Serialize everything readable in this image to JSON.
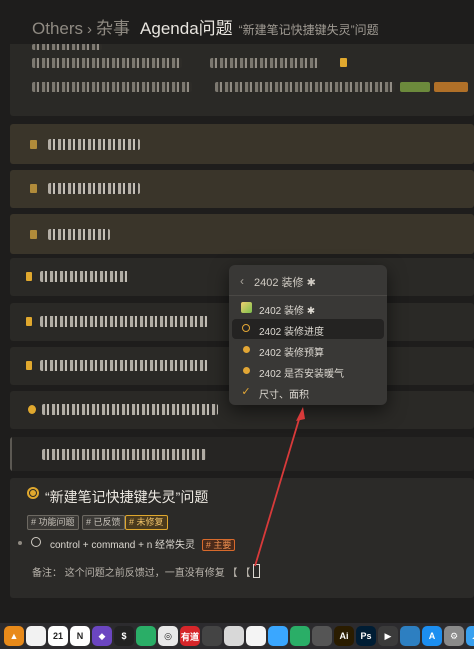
{
  "header": {
    "breadcrumb_root": "Others",
    "breadcrumb_sep": "›",
    "breadcrumb_parent": "杂事",
    "page_title": "Agenda问题",
    "page_subtitle": "“新建笔记快捷键失灵”问题"
  },
  "popup": {
    "back_glyph": "‹",
    "title": "2402 装修 ✱",
    "items": [
      {
        "label": "2402 装修 ✱",
        "icon": "note-icon",
        "selected": false
      },
      {
        "label": "2402 装修进度",
        "icon": "open-circle-icon",
        "selected": true
      },
      {
        "label": "2402 装修预算",
        "icon": "dot-icon",
        "selected": false
      },
      {
        "label": "2402 是否安装暖气",
        "icon": "dot-icon",
        "selected": false
      },
      {
        "label": "尺寸、面积",
        "icon": "check-icon",
        "selected": false
      }
    ]
  },
  "note": {
    "title": "“新建笔记快捷键失灵”问题",
    "tags": [
      "# 功能问题",
      "# 已反馈",
      "# 未修复"
    ],
    "task_text": "control + command + n 经常失灵",
    "task_tag": "# 主要",
    "remark": "备注：  这个问题之前反馈过，一直没有修复 【 【"
  },
  "dock": {
    "icons": [
      {
        "name": "vlc-icon",
        "color": "#e88a1a",
        "glyph": "▲"
      },
      {
        "name": "reminders-icon",
        "color": "#f2f2f2",
        "glyph": ""
      },
      {
        "name": "calendar-icon",
        "color": "#ffffff",
        "glyph": "21"
      },
      {
        "name": "notion-icon",
        "color": "#ffffff",
        "glyph": "N"
      },
      {
        "name": "obsidian-icon",
        "color": "#6b46c1",
        "glyph": "◆"
      },
      {
        "name": "dollar-app-icon",
        "color": "#222222",
        "glyph": "$"
      },
      {
        "name": "wechat-icon",
        "color": "#2aae67",
        "glyph": ""
      },
      {
        "name": "chrome-icon",
        "color": "#e8e8e8",
        "glyph": "◎"
      },
      {
        "name": "youdao-icon",
        "color": "#d6262a",
        "glyph": "有道"
      },
      {
        "name": "grid-app-icon",
        "color": "#444444",
        "glyph": ""
      },
      {
        "name": "pages-icon",
        "color": "#d8d8d8",
        "glyph": ""
      },
      {
        "name": "airmail-icon",
        "color": "#f4f4f4",
        "glyph": ""
      },
      {
        "name": "messages-icon",
        "color": "#3aa7ff",
        "glyph": ""
      },
      {
        "name": "wechat-icon-2",
        "color": "#2aae67",
        "glyph": ""
      },
      {
        "name": "window-app-icon",
        "color": "#555555",
        "glyph": ""
      },
      {
        "name": "illustrator-icon",
        "color": "#2a1c00",
        "glyph": "Ai"
      },
      {
        "name": "photoshop-icon",
        "color": "#001d34",
        "glyph": "Ps"
      },
      {
        "name": "media-player-icon",
        "color": "#3b3b3b",
        "glyph": "▶"
      },
      {
        "name": "agenda-icon",
        "color": "#2d7fc1",
        "glyph": ""
      },
      {
        "name": "app-store-icon",
        "color": "#1c8ef0",
        "glyph": "A"
      },
      {
        "name": "settings-icon",
        "color": "#8a8a8a",
        "glyph": "⚙"
      },
      {
        "name": "cloud-icon",
        "color": "#39a1f0",
        "glyph": "☁"
      }
    ]
  },
  "colors": {
    "accent": "#e2a635",
    "arrow": "#d83a3a",
    "background": "#1e1d1c"
  }
}
